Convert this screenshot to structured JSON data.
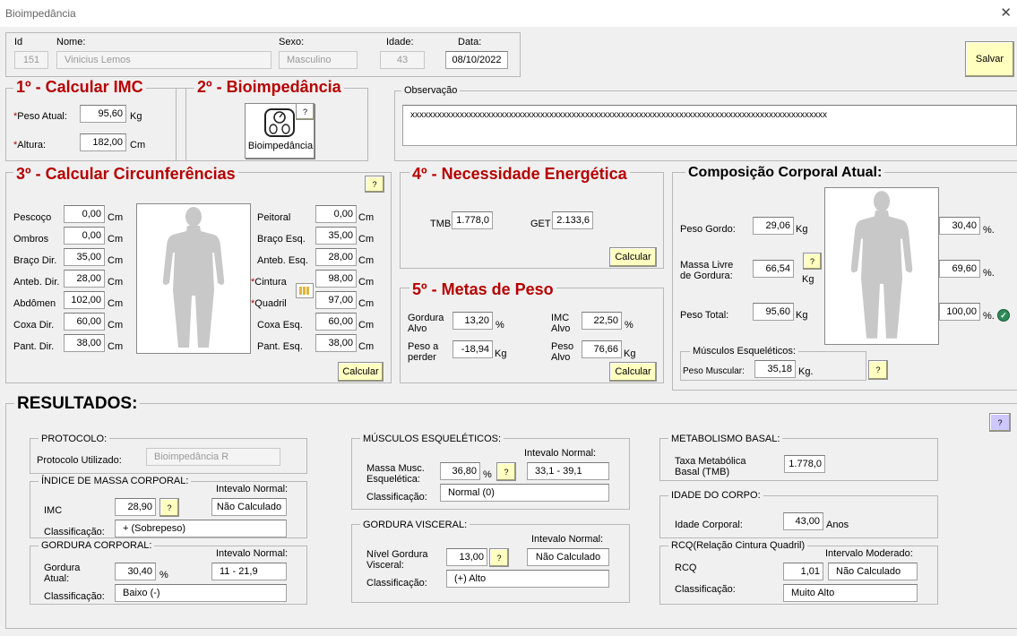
{
  "window": {
    "title": "Bioimpedância",
    "close": "✕"
  },
  "header": {
    "id_label": "Id",
    "id_value": "151",
    "name_label": "Nome:",
    "name_value": "Vinicius  Lemos",
    "sex_label": "Sexo:",
    "sex_value": "Masculino",
    "age_label": "Idade:",
    "age_value": "43",
    "date_label": "Data:",
    "date_value": "08/10/2022",
    "save": "Salvar"
  },
  "imc": {
    "title": "1º - Calcular IMC",
    "ast": "*",
    "weight_label": "Peso Atual:",
    "weight_value": "95,60",
    "weight_unit": "Kg",
    "height_label": "Altura:",
    "height_value": "182,00",
    "height_unit": "Cm"
  },
  "bio": {
    "title": "2º - Bioimpedância",
    "button": "Bioimpedância",
    "help": "?"
  },
  "obs": {
    "title": "Observação",
    "value": "xxxxxxxxxxxxxxxxxxxxxxxxxxxxxxxxxxxxxxxxxxxxxxxxxxxxxxxxxxxxxxxxxxxxxxxxxxxxxxxxxxxxxxxxxxxxx"
  },
  "circ": {
    "title": "3º - Calcular Circunferências",
    "help": "?",
    "unit": "Cm",
    "calc": "Calcular",
    "left": [
      {
        "label": "Pescoço",
        "value": "0,00"
      },
      {
        "label": "Ombros",
        "value": "0,00"
      },
      {
        "label": "Braço Dir.",
        "value": "35,00"
      },
      {
        "label": "Anteb. Dir.",
        "value": "28,00"
      },
      {
        "label": "Abdômen",
        "value": "102,00"
      },
      {
        "label": "Coxa Dir.",
        "value": "60,00"
      },
      {
        "label": "Pant.  Dir.",
        "value": "38,00"
      }
    ],
    "right": [
      {
        "label": "Peitoral",
        "value": "0,00"
      },
      {
        "label": "Braço Esq.",
        "value": "35,00"
      },
      {
        "label": "Anteb. Esq.",
        "value": "28,00"
      },
      {
        "label": "Cintura",
        "value": "98,00",
        "ast": "*"
      },
      {
        "label": "Quadril",
        "value": "97,00",
        "ast": "*"
      },
      {
        "label": "Coxa Esq.",
        "value": "60,00"
      },
      {
        "label": "Pant. Esq.",
        "value": "38,00"
      }
    ]
  },
  "energy": {
    "title": "4º - Necessidade Energética",
    "tmb_label": "TMB",
    "tmb_value": "1.778,0",
    "get_label": "GET",
    "get_value": "2.133,6",
    "calc": "Calcular"
  },
  "goals": {
    "title": "5º - Metas de Peso",
    "fat_label": "Gordura Alvo",
    "fat_value": "13,20",
    "fat_unit": "%",
    "imc_label": "IMC Alvo",
    "imc_value": "22,50",
    "imc_unit": "%",
    "lose_label": "Peso a perder",
    "lose_value": "-18,94",
    "lose_unit": "Kg",
    "weight_label": "Peso Alvo",
    "weight_value": "76,66",
    "weight_unit": "Kg",
    "calc": "Calcular"
  },
  "comp": {
    "title": "Composição Corporal Atual:",
    "fat_label": "Peso Gordo:",
    "fat_value": "29,06",
    "fat_unit": "Kg",
    "fat_pct": "30,40",
    "lean_label": "Massa  Livre de Gordura:",
    "lean_value": "66,54",
    "lean_unit": "Kg",
    "lean_pct": "69,60",
    "total_label": "Peso Total:",
    "total_value": "95,60",
    "total_unit": "Kg",
    "total_pct": "100,00",
    "pct": "%.",
    "help": "?",
    "mus_title": "Músculos Esqueléticos:",
    "mus_label": "Peso Muscular:",
    "mus_value": "35,18",
    "mus_unit": "Kg."
  },
  "results": {
    "title": "RESULTADOS:",
    "help": "?",
    "protocol": {
      "title": "PROTOCOLO:",
      "label": "Protocolo Utilizado:",
      "value": "Bioimpedância R"
    },
    "imc": {
      "title": "ÍNDICE DE MASSA CORPORAL:",
      "normal": "Intevalo Normal:",
      "label": "IMC",
      "value": "28,90",
      "help": "?",
      "range": "Não Calculado",
      "class_label": "Classificação:",
      "class_value": "+ (Sobrepeso)"
    },
    "fat": {
      "title": "GORDURA CORPORAL:",
      "normal": "Intevalo Normal:",
      "label": "Gordura Atual:",
      "value": "30,40",
      "unit": "%",
      "range": "11 - 21,9",
      "class_label": "Classificação:",
      "class_value": "Baixo (-)"
    },
    "muscle": {
      "title": "MÚSCULOS ESQUELÉTICOS:",
      "normal": "Intevalo Normal:",
      "label": "Massa Musc. Esquelética:",
      "value": "36,80",
      "unit": "%",
      "help": "?",
      "range": "33,1 - 39,1",
      "class_label": "Classificação:",
      "class_value": "Normal (0)"
    },
    "visceral": {
      "title": "GORDURA VISCERAL:",
      "normal": "Intevalo Normal:",
      "label": "Nível Gordura Visceral:",
      "value": "13,00",
      "help": "?",
      "range": "Não Calculado",
      "class_label": "Classificação:",
      "class_value": "(+) Alto"
    },
    "basal": {
      "title": "METABOLISMO BASAL:",
      "label": "Taxa Metabólica Basal (TMB)",
      "value": "1.778,0"
    },
    "age": {
      "title": "IDADE DO CORPO:",
      "label": "Idade Corporal:",
      "value": "43,00",
      "unit": "Anos"
    },
    "rcq": {
      "title": "RCQ(Relação Cintura Quadril)",
      "moderate": "Intervalo Moderado:",
      "label": "RCQ",
      "value": "1,01",
      "range": "Não Calculado",
      "class_label": "Classificação:",
      "class_value": "Muito Alto"
    }
  },
  "icons": {
    "scale": "scale-icon",
    "body": "body-silhouette-icon",
    "check": "check-circle-icon",
    "calc": "calculator-icon"
  }
}
